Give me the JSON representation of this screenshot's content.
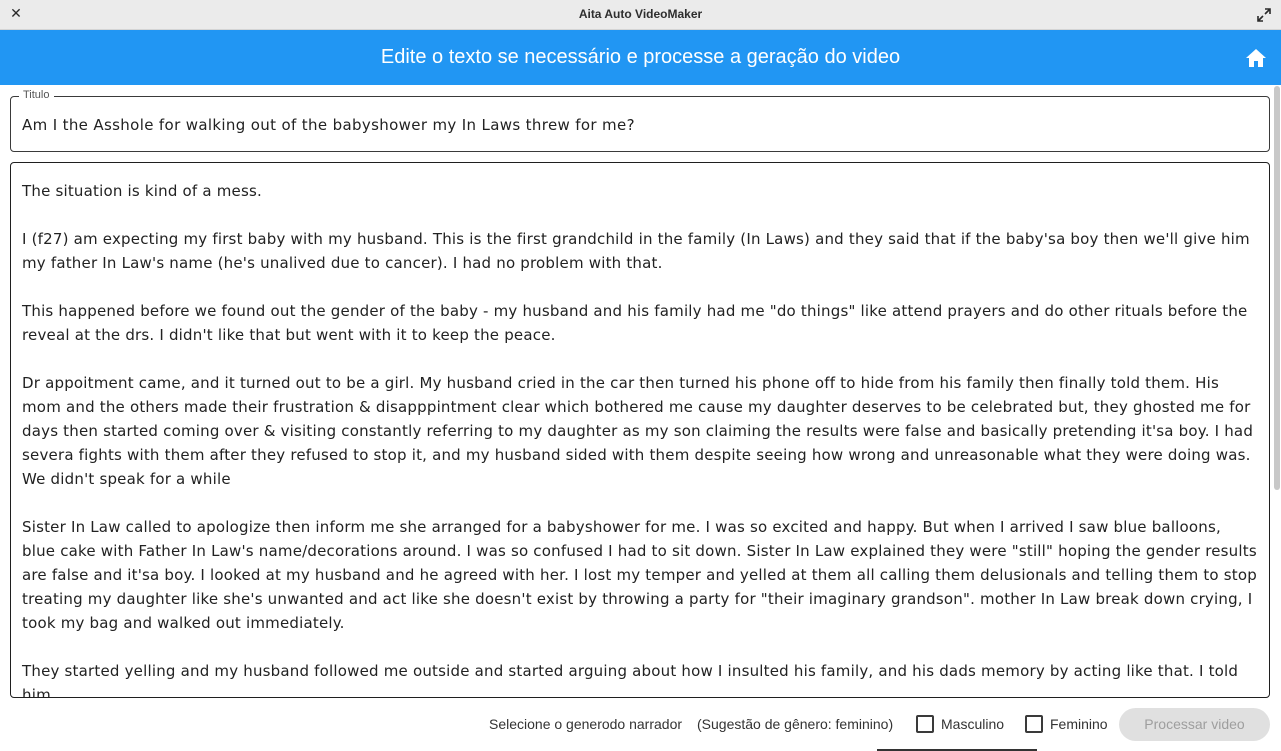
{
  "window": {
    "title": "Aita Auto VideoMaker",
    "close_icon": "close-icon",
    "expand_icon": "expand-icon"
  },
  "appbar": {
    "heading": "Edite o texto se necessário e processe a geração do video",
    "home_icon": "home-icon",
    "color": "#2196f3"
  },
  "title_field": {
    "label": "Titulo",
    "value": "Am I the Asshole for walking out of the babyshower my In Laws threw for me?"
  },
  "body_field": {
    "value": "The situation is kind of a mess.\n\nI (f27) am expecting my first baby with my husband. This is the first grandchild in the family (In Laws) and they said that if the baby'sa boy then we'll give him my father In Law's name (he's unalived due to cancer). I had no problem with that.\n\nThis happened before we found out the gender of the baby - my husband and his family had me \"do things\" like attend prayers and do other rituals before the reveal at the drs. I didn't like that but went with it to keep the peace.\n\nDr appoitment came, and it turned out to be a girl. My husband cried in the car then turned his phone off to hide from his family then finally told them. His mom and the others made their frustration & disapppintment clear which bothered me cause my daughter deserves to be celebrated but, they ghosted me for days then started coming over & visiting constantly referring to my daughter as my son claiming the results were false and basically pretending it'sa boy. I had severa fights with them after they refused to stop it, and my husband sided with them despite seeing how wrong and unreasonable what they were doing was. We didn't speak for a while\n\nSister In Law called to apologize then inform me she arranged for a babyshower for me. I was so excited and happy. But when I arrived I saw blue balloons, blue cake with Father In Law's name/decorations around. I was so confused I had to sit down. Sister In Law explained they were \"still\" hoping the gender results are false and it'sa boy. I looked at my husband and he agreed with her. I lost my temper and yelled at them all calling them delusionals and telling them to stop treating my daughter like she's unwanted and act like she doesn't exist by throwing a party for \"their imaginary grandson\". mother In Law break down crying, I took my bag and walked out immediately.\n\nThey started yelling and my husband followed me outside and started arguing about how I insulted his family, and his dads memory by acting like that. I told him"
  },
  "footer": {
    "narrator_label": "Selecione o generodo narrador",
    "suggestion": "(Sugestão de gênero: feminino)",
    "option_male": "Masculino",
    "option_female": "Feminino",
    "process_button": "Processar video"
  }
}
